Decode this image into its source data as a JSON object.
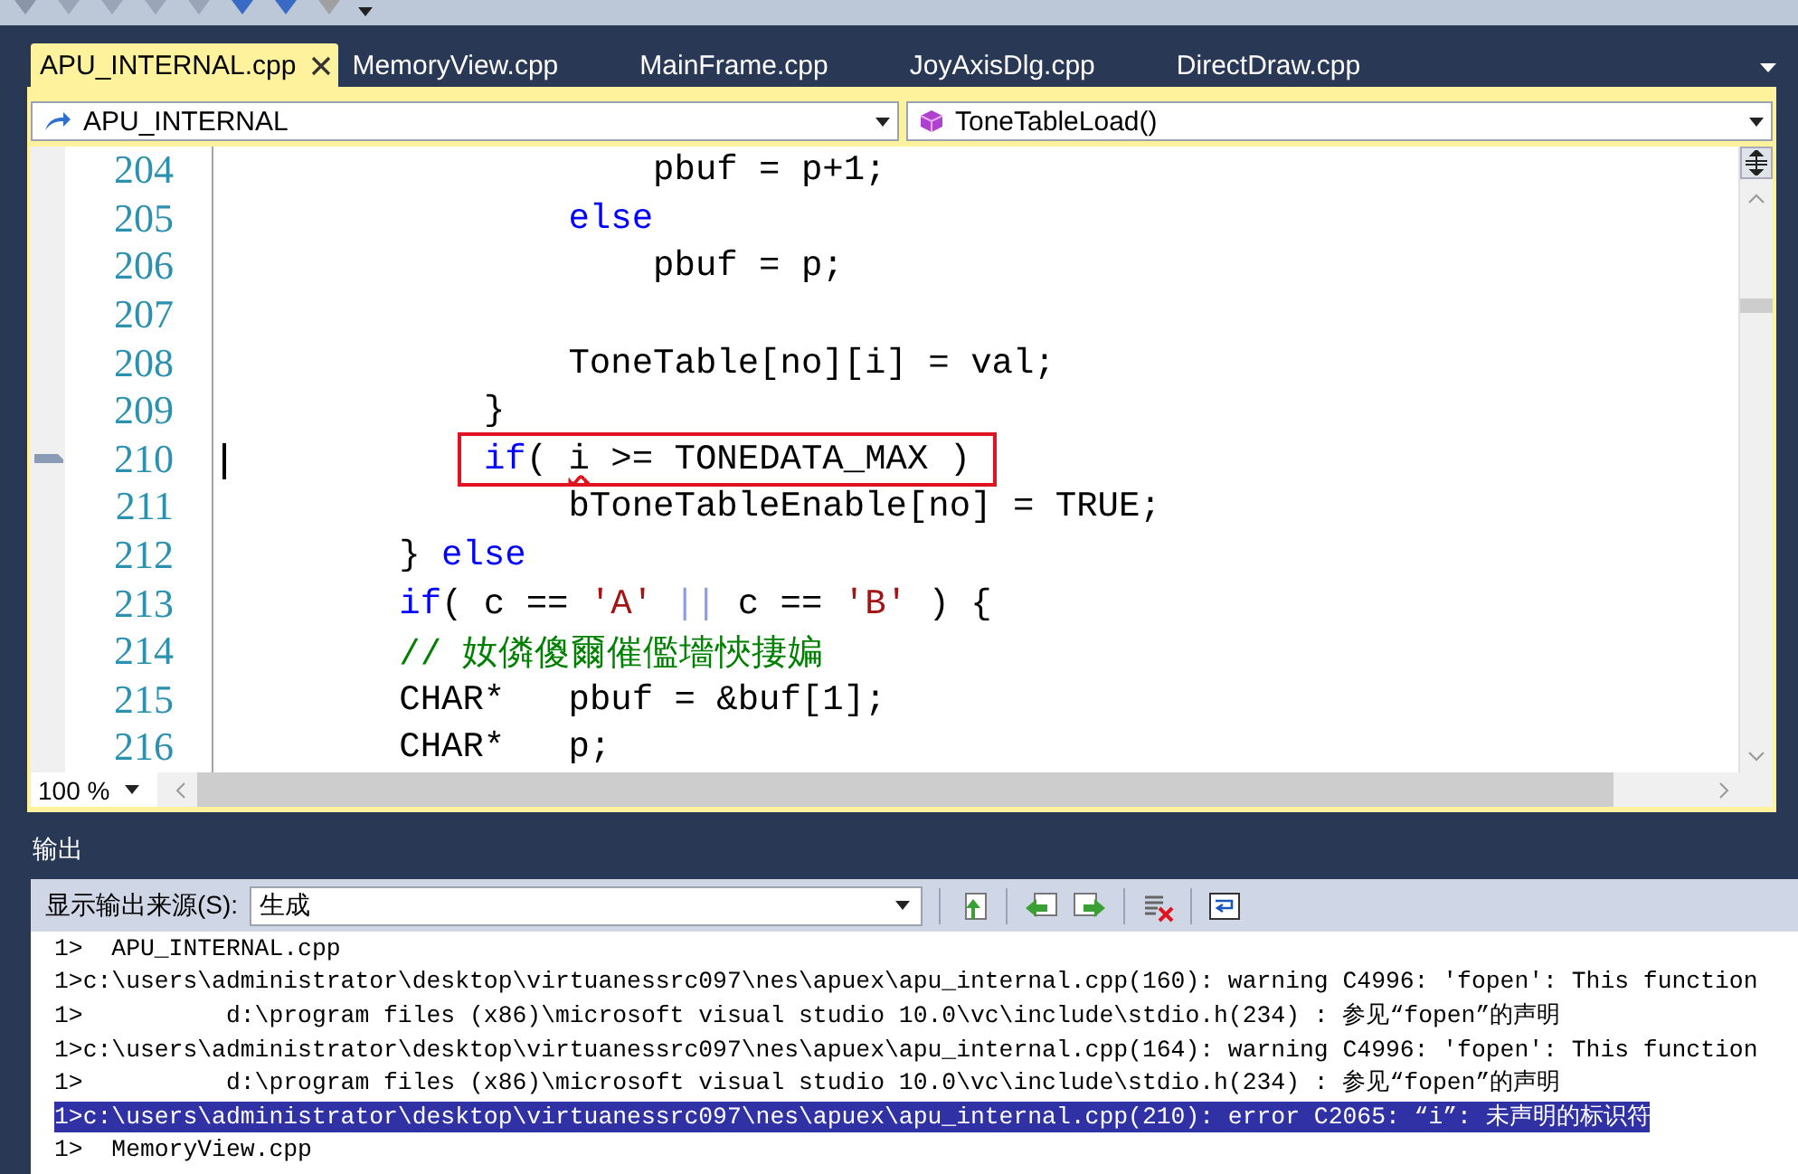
{
  "tabs": [
    {
      "label": "APU_INTERNAL.cpp",
      "selected": true
    },
    {
      "label": "MemoryView.cpp",
      "selected": false
    },
    {
      "label": "MainFrame.cpp",
      "selected": false
    },
    {
      "label": "JoyAxisDlg.cpp",
      "selected": false
    },
    {
      "label": "DirectDraw.cpp",
      "selected": false
    }
  ],
  "navigation": {
    "scope": "APU_INTERNAL",
    "member": "ToneTableLoad()"
  },
  "editor": {
    "lines": [
      {
        "number": "204",
        "marked": false,
        "cursor": false,
        "boxed": false,
        "segments": [
          {
            "kind": "plain",
            "text": "                    pbuf = p+1;"
          }
        ]
      },
      {
        "number": "205",
        "marked": false,
        "cursor": false,
        "boxed": false,
        "segments": [
          {
            "kind": "keyword",
            "text": "                else"
          }
        ]
      },
      {
        "number": "206",
        "marked": false,
        "cursor": false,
        "boxed": false,
        "segments": [
          {
            "kind": "plain",
            "text": "                    pbuf = p;"
          }
        ]
      },
      {
        "number": "207",
        "marked": false,
        "cursor": false,
        "boxed": false
      },
      {
        "number": "208",
        "marked": false,
        "cursor": false,
        "boxed": false,
        "segments": [
          {
            "kind": "plain",
            "text": "                ToneTable[no][i] = val;"
          }
        ]
      },
      {
        "number": "209",
        "marked": false,
        "cursor": false,
        "boxed": false,
        "segments": [
          {
            "kind": "plain",
            "text": "            }"
          }
        ]
      },
      {
        "number": "210",
        "marked": true,
        "cursor": true,
        "boxed": true,
        "segments": [
          {
            "kind": "keyword",
            "text": "            if"
          },
          {
            "kind": "plain",
            "text": "( "
          },
          {
            "kind": "error",
            "text": "i"
          },
          {
            "kind": "plain",
            "text": " >= TONEDATA_MAX )"
          }
        ]
      },
      {
        "number": "211",
        "marked": false,
        "cursor": false,
        "boxed": false,
        "segments": [
          {
            "kind": "plain",
            "text": "                bToneTableEnable[no] = TRUE;"
          }
        ]
      },
      {
        "number": "212",
        "marked": false,
        "cursor": false,
        "boxed": false,
        "segments": [
          {
            "kind": "plain",
            "text": "        } "
          },
          {
            "kind": "keyword",
            "text": "else"
          }
        ]
      },
      {
        "number": "213",
        "marked": false,
        "cursor": false,
        "boxed": false,
        "segments": [
          {
            "kind": "keyword",
            "text": "        if"
          },
          {
            "kind": "plain",
            "text": "( c == "
          },
          {
            "kind": "string",
            "text": "'A'"
          },
          {
            "kind": "operator",
            "text": " || "
          },
          {
            "kind": "plain",
            "text": "c == "
          },
          {
            "kind": "string",
            "text": "'B'"
          },
          {
            "kind": "plain",
            "text": " ) {"
          }
        ]
      },
      {
        "number": "214",
        "marked": false,
        "cursor": false,
        "boxed": false,
        "segments": [
          {
            "kind": "comment",
            "text": "        // 奻僯傻爾催儖墻悏捿媥"
          }
        ]
      },
      {
        "number": "215",
        "marked": false,
        "cursor": false,
        "boxed": false,
        "segments": [
          {
            "kind": "plain",
            "text": "        CHAR*   pbuf = &buf[1];"
          }
        ]
      },
      {
        "number": "216",
        "marked": false,
        "cursor": false,
        "boxed": false,
        "segments": [
          {
            "kind": "plain",
            "text": "        CHAR*   p;"
          }
        ]
      }
    ],
    "zoom": "100 %"
  },
  "output": {
    "title": "输出",
    "source_label": "显示输出来源(S):",
    "source_value": "生成",
    "lines": [
      {
        "text": "1>  APU_INTERNAL.cpp",
        "selected": false
      },
      {
        "text": "1>c:\\users\\administrator\\desktop\\virtuanessrc097\\nes\\apuex\\apu_internal.cpp(160): warning C4996: 'fopen': This function",
        "selected": false
      },
      {
        "text": "1>          d:\\program files (x86)\\microsoft visual studio 10.0\\vc\\include\\stdio.h(234) : 参见“fopen”的声明",
        "selected": false
      },
      {
        "text": "1>c:\\users\\administrator\\desktop\\virtuanessrc097\\nes\\apuex\\apu_internal.cpp(164): warning C4996: 'fopen': This function",
        "selected": false
      },
      {
        "text": "1>          d:\\program files (x86)\\microsoft visual studio 10.0\\vc\\include\\stdio.h(234) : 参见“fopen”的声明",
        "selected": false
      },
      {
        "text": "1>c:\\users\\administrator\\desktop\\virtuanessrc097\\nes\\apuex\\apu_internal.cpp(210): error C2065: “i”: 未声明的标识符",
        "selected": true
      },
      {
        "text": "1>  MemoryView.cpp",
        "selected": false
      }
    ]
  }
}
